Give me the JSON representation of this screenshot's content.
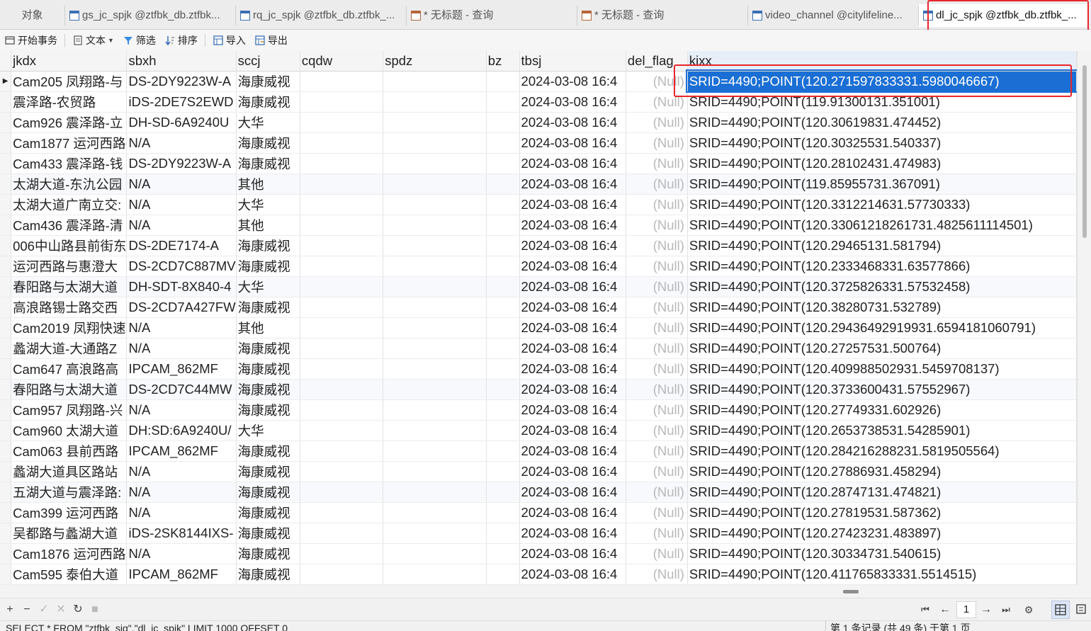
{
  "tabs": [
    {
      "label": "对象",
      "icon": "none"
    },
    {
      "label": "gs_jc_spjk @ztfbk_db.ztfbk...",
      "icon": "table-icon"
    },
    {
      "label": "rq_jc_spjk @ztfbk_db.ztfbk_...",
      "icon": "table-icon"
    },
    {
      "label": "* 无标题 - 查询",
      "icon": "query-icon"
    },
    {
      "label": "* 无标题 - 查询",
      "icon": "query-icon"
    },
    {
      "label": "video_channel @citylifeline...",
      "icon": "table-icon"
    },
    {
      "label": "dl_jc_spjk @ztfbk_db.ztfbk_...",
      "icon": "table-icon"
    }
  ],
  "toolbar": {
    "begin_transaction": "开始事务",
    "text": "文本",
    "filter": "筛选",
    "sort": "排序",
    "import": "导入",
    "export": "导出"
  },
  "grid": {
    "columns": [
      "jkdx",
      "sbxh",
      "sccj",
      "cqdw",
      "spdz",
      "bz",
      "tbsj",
      "del_flag",
      "kixx"
    ],
    "rows": [
      [
        "Cam205 凤翔路-与",
        "DS-2DY9223W-A",
        "海康威视",
        "",
        "",
        "",
        "2024-03-08 16:4",
        "(Null)",
        "SRID=4490;POINT(120.271597833331.5980046667)"
      ],
      [
        "震泽路-农贸路",
        "iDS-2DE7S2EWD",
        "海康威视",
        "",
        "",
        "",
        "2024-03-08 16:4",
        "(Null)",
        "SRID=4490;POINT(119.91300131.351001)"
      ],
      [
        "Cam926 震泽路-立",
        "DH-SD-6A9240U",
        "大华",
        "",
        "",
        "",
        "2024-03-08 16:4",
        "(Null)",
        "SRID=4490;POINT(120.30619831.474452)"
      ],
      [
        "Cam1877 运河西路",
        "N/A",
        "海康威视",
        "",
        "",
        "",
        "2024-03-08 16:4",
        "(Null)",
        "SRID=4490;POINT(120.30325531.540337)"
      ],
      [
        "Cam433 震泽路-钱",
        "DS-2DY9223W-A",
        "海康威视",
        "",
        "",
        "",
        "2024-03-08 16:4",
        "(Null)",
        "SRID=4490;POINT(120.28102431.474983)"
      ],
      [
        "太湖大道-东氿公园",
        "N/A",
        "其他",
        "",
        "",
        "",
        "2024-03-08 16:4",
        "(Null)",
        "SRID=4490;POINT(119.85955731.367091)"
      ],
      [
        "太湖大道广南立交:",
        "N/A",
        "大华",
        "",
        "",
        "",
        "2024-03-08 16:4",
        "(Null)",
        "SRID=4490;POINT(120.3312214631.57730333)"
      ],
      [
        "Cam436 震泽路-清",
        "N/A",
        "其他",
        "",
        "",
        "",
        "2024-03-08 16:4",
        "(Null)",
        "SRID=4490;POINT(120.33061218261731.4825611114501)"
      ],
      [
        "006中山路县前街东",
        "DS-2DE7174-A",
        "海康威视",
        "",
        "",
        "",
        "2024-03-08 16:4",
        "(Null)",
        "SRID=4490;POINT(120.29465131.581794)"
      ],
      [
        "运河西路与惠澄大",
        "DS-2CD7C887MV",
        "海康威视",
        "",
        "",
        "",
        "2024-03-08 16:4",
        "(Null)",
        "SRID=4490;POINT(120.2333468331.63577866)"
      ],
      [
        "春阳路与太湖大道",
        "DH-SDT-8X840-4",
        "大华",
        "",
        "",
        "",
        "2024-03-08 16:4",
        "(Null)",
        "SRID=4490;POINT(120.3725826331.57532458)"
      ],
      [
        "高浪路锡士路交西",
        "DS-2CD7A427FW",
        "海康威视",
        "",
        "",
        "",
        "2024-03-08 16:4",
        "(Null)",
        "SRID=4490;POINT(120.38280731.532789)"
      ],
      [
        "Cam2019 凤翔快速",
        "N/A",
        "其他",
        "",
        "",
        "",
        "2024-03-08 16:4",
        "(Null)",
        "SRID=4490;POINT(120.29436492919931.6594181060791)"
      ],
      [
        "蠡湖大道-大通路Z",
        "N/A",
        "海康威视",
        "",
        "",
        "",
        "2024-03-08 16:4",
        "(Null)",
        "SRID=4490;POINT(120.27257531.500764)"
      ],
      [
        "Cam647 高浪路高",
        "IPCAM_862MF",
        "海康威视",
        "",
        "",
        "",
        "2024-03-08 16:4",
        "(Null)",
        "SRID=4490;POINT(120.409988502931.5459708137)"
      ],
      [
        "春阳路与太湖大道",
        "DS-2CD7C44MW",
        "海康威视",
        "",
        "",
        "",
        "2024-03-08 16:4",
        "(Null)",
        "SRID=4490;POINT(120.3733600431.57552967)"
      ],
      [
        "Cam957 凤翔路-兴",
        "N/A",
        "海康威视",
        "",
        "",
        "",
        "2024-03-08 16:4",
        "(Null)",
        "SRID=4490;POINT(120.27749331.602926)"
      ],
      [
        "Cam960 太湖大道",
        "DH:SD:6A9240U/",
        "大华",
        "",
        "",
        "",
        "2024-03-08 16:4",
        "(Null)",
        "SRID=4490;POINT(120.2653738531.54285901)"
      ],
      [
        "Cam063 县前西路",
        "IPCAM_862MF",
        "海康威视",
        "",
        "",
        "",
        "2024-03-08 16:4",
        "(Null)",
        "SRID=4490;POINT(120.284216288231.5819505564)"
      ],
      [
        "蠡湖大道具区路站",
        "N/A",
        "海康威视",
        "",
        "",
        "",
        "2024-03-08 16:4",
        "(Null)",
        "SRID=4490;POINT(120.27886931.458294)"
      ],
      [
        "五湖大道与震泽路:",
        "N/A",
        "海康威视",
        "",
        "",
        "",
        "2024-03-08 16:4",
        "(Null)",
        "SRID=4490;POINT(120.28747131.474821)"
      ],
      [
        "Cam399 运河西路",
        "N/A",
        "海康威视",
        "",
        "",
        "",
        "2024-03-08 16:4",
        "(Null)",
        "SRID=4490;POINT(120.27819531.587362)"
      ],
      [
        "吴都路与蠡湖大道",
        "iDS-2SK8144IXS-",
        "海康威视",
        "",
        "",
        "",
        "2024-03-08 16:4",
        "(Null)",
        "SRID=4490;POINT(120.27423231.483897)"
      ],
      [
        "Cam1876 运河西路",
        "N/A",
        "海康威视",
        "",
        "",
        "",
        "2024-03-08 16:4",
        "(Null)",
        "SRID=4490;POINT(120.30334731.540615)"
      ],
      [
        "Cam595 泰伯大道",
        "IPCAM_862MF",
        "海康威视",
        "",
        "",
        "",
        "2024-03-08 16:4",
        "(Null)",
        "SRID=4490;POINT(120.411765833331.5514515)"
      ]
    ],
    "selected_row": 0,
    "selected_column": "kixx"
  },
  "pagination": {
    "current_page": "1"
  },
  "status": {
    "sql": "SELECT * FROM \"ztfbk_sjg\".\"dl_jc_spjk\" LIMIT 1000 OFFSET 0",
    "records": "第 1 条记录 (共 49 条) 于第 1 页"
  },
  "colors": {
    "selection": "#1b6fd4",
    "highlight_box": "#e8262b",
    "null_text": "#b8b8b8"
  }
}
